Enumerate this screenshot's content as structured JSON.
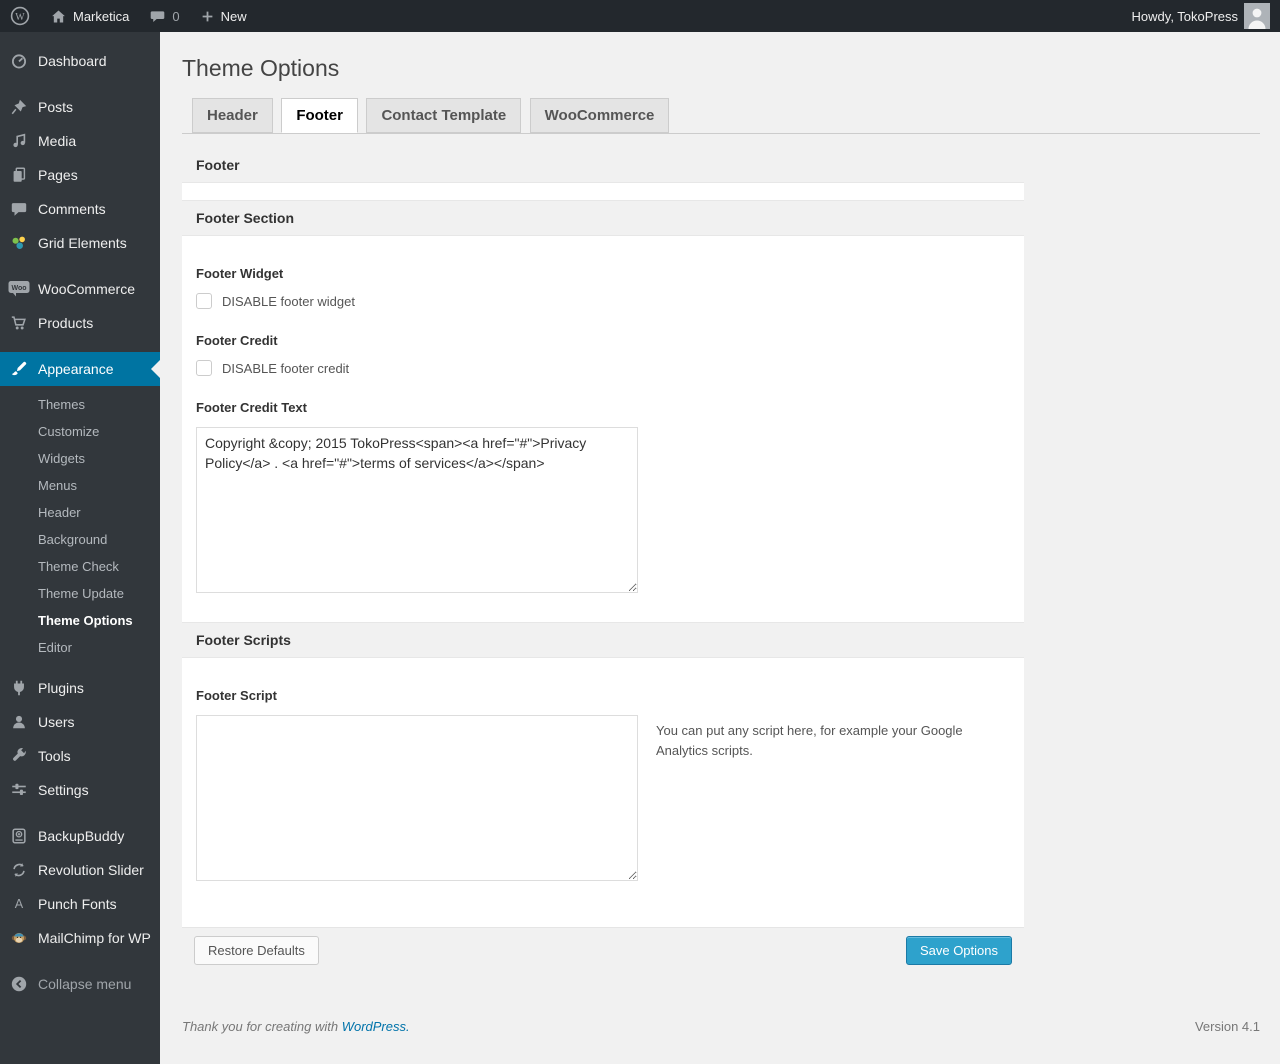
{
  "colors": {
    "accent": "#0074a2",
    "primary_button": "#2ea2cc",
    "link": "#0073aa",
    "adminbar": "#23282d",
    "sidebar": "#32373c"
  },
  "admin_bar": {
    "site_name": "Marketica",
    "comment_count": "0",
    "new_label": "New",
    "howdy": "Howdy, TokoPress"
  },
  "sidebar": {
    "items": [
      {
        "label": "Dashboard",
        "icon": "gauge"
      },
      {
        "label": "Posts",
        "icon": "pushpin"
      },
      {
        "label": "Media",
        "icon": "music-note"
      },
      {
        "label": "Pages",
        "icon": "stacked-pages"
      },
      {
        "label": "Comments",
        "icon": "speech-bubble"
      },
      {
        "label": "Grid Elements",
        "icon": "color-cluster"
      },
      {
        "label": "WooCommerce",
        "icon": "woo-badge"
      },
      {
        "label": "Products",
        "icon": "cart"
      },
      {
        "label": "Appearance",
        "icon": "paintbrush",
        "active": true
      },
      {
        "label": "Plugins",
        "icon": "plug"
      },
      {
        "label": "Users",
        "icon": "person"
      },
      {
        "label": "Tools",
        "icon": "wrench"
      },
      {
        "label": "Settings",
        "icon": "sliders"
      },
      {
        "label": "BackupBuddy",
        "icon": "backup-drive"
      },
      {
        "label": "Revolution Slider",
        "icon": "circular-arrows"
      },
      {
        "label": "Punch Fonts",
        "icon": "letter-a"
      },
      {
        "label": "MailChimp for WP",
        "icon": "monkey"
      },
      {
        "label": "Collapse menu",
        "icon": "collapse-arrow"
      }
    ],
    "appearance_submenu": [
      {
        "label": "Themes"
      },
      {
        "label": "Customize"
      },
      {
        "label": "Widgets"
      },
      {
        "label": "Menus"
      },
      {
        "label": "Header"
      },
      {
        "label": "Background"
      },
      {
        "label": "Theme Check"
      },
      {
        "label": "Theme Update"
      },
      {
        "label": "Theme Options",
        "current": true
      },
      {
        "label": "Editor"
      }
    ]
  },
  "page": {
    "title": "Theme Options",
    "tabs": [
      {
        "label": "Header",
        "active": false
      },
      {
        "label": "Footer",
        "active": true
      },
      {
        "label": "Contact Template",
        "active": false
      },
      {
        "label": "WooCommerce",
        "active": false
      }
    ]
  },
  "panel": {
    "header": "Footer",
    "footer_section": {
      "title": "Footer Section",
      "footer_widget": {
        "label": "Footer Widget",
        "checkbox_label": "DISABLE footer widget",
        "checked": false
      },
      "footer_credit": {
        "label": "Footer Credit",
        "checkbox_label": "DISABLE footer credit",
        "checked": false
      },
      "footer_credit_text": {
        "label": "Footer Credit Text",
        "value": "Copyright &copy; 2015 TokoPress<span><a href=\"#\">Privacy Policy</a> . <a href=\"#\">terms of services</a></span>"
      }
    },
    "footer_scripts": {
      "title": "Footer Scripts",
      "footer_script": {
        "label": "Footer Script",
        "value": "",
        "help": "You can put any script here, for example your Google Analytics scripts."
      }
    },
    "actions": {
      "restore": "Restore Defaults",
      "save": "Save Options"
    }
  },
  "footer": {
    "thanks": "Thank you for creating with",
    "wordpress_link": "WordPress.",
    "version": "Version 4.1"
  }
}
